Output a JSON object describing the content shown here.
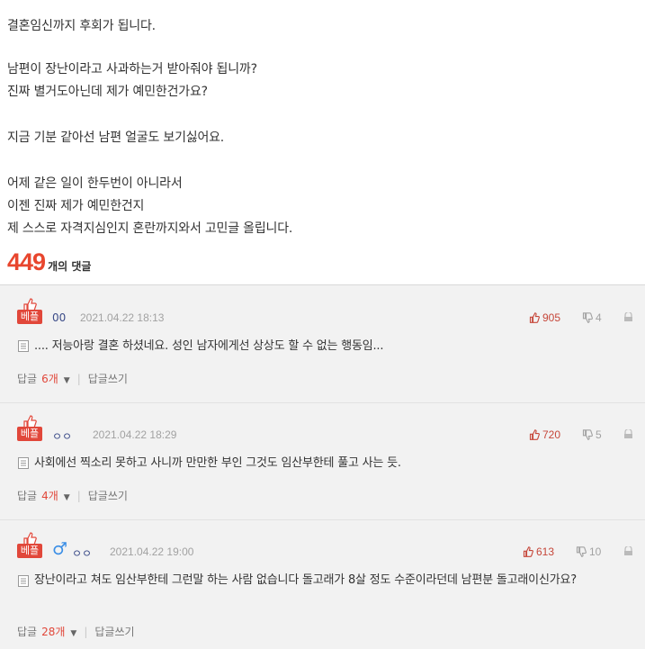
{
  "post": {
    "lines": [
      "결혼임신까지 후회가 됩니다.",
      "남편이 장난이라고 사과하는거 받아줘야 됩니까?",
      "진짜 별거도아닌데 제가 예민한건가요?",
      "지금 기분 같아선 남편 얼굴도 보기싫어요.",
      "어제 같은 일이 한두번이 아니라서",
      "이젠 진짜 제가 예민한건지",
      "제 스스로 자격지심인지 혼란까지와서 고민글 올립니다."
    ]
  },
  "comment_count": {
    "number": "449",
    "label": "개의 댓글"
  },
  "comments": [
    {
      "badge": "베플",
      "nickname": "00",
      "date": "2021.04.22 18:13",
      "upvotes": "905",
      "downvotes": "4",
      "text": ".... 저능아랑 결혼 하셨네요. 성인 남자에게선 상상도 할 수 없는 행동임...",
      "reply_label": "답글",
      "reply_count": "6개",
      "write_reply": "답글쓰기"
    },
    {
      "badge": "베플",
      "nickname": "ㅇㅇ",
      "date": "2021.04.22 18:29",
      "upvotes": "720",
      "downvotes": "5",
      "text": "사회에선 찍소리 못하고 사니까 만만한 부인 그것도 임산부한테 풀고 사는 듯.",
      "reply_label": "답글",
      "reply_count": "4개",
      "write_reply": "답글쓰기"
    },
    {
      "badge": "베플",
      "gender_icon": "male-icon",
      "nickname": "ㅇㅇ",
      "date": "2021.04.22 19:00",
      "upvotes": "613",
      "downvotes": "10",
      "text": "장난이라고 쳐도 임산부한테 그런말 하는 사람 없습니다 돌고래가 8살 정도 수준이라던데 남편분 돌고래이신가요?",
      "reply_label": "답글",
      "reply_count": "28개",
      "write_reply": "답글쓰기"
    }
  ],
  "colors": {
    "accent": "#e8462e",
    "badge": "#e1473a",
    "nickname": "#3b4b88",
    "male": "#3a8ee6"
  }
}
